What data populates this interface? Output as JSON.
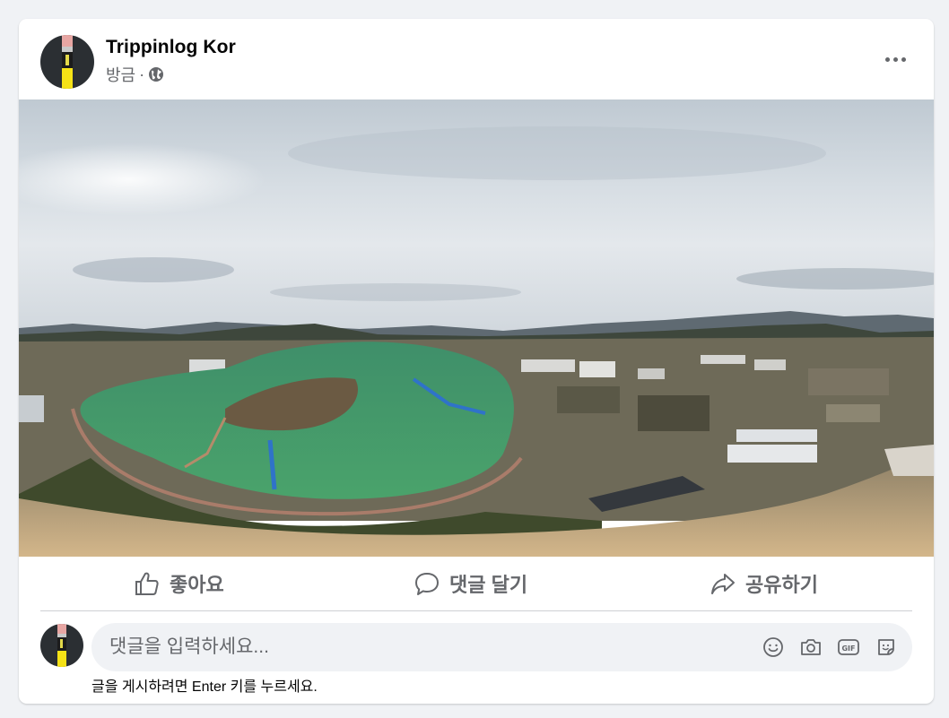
{
  "post": {
    "author": "Trippinlog Kor",
    "timestamp": "방금",
    "separator": "·",
    "privacy_icon": "globe-icon",
    "more_icon": "more-options-icon"
  },
  "photo": {
    "subject": "aerial panoramic photo of a lake and resort town"
  },
  "actions": {
    "like_label": "좋아요",
    "comment_label": "댓글 달기",
    "share_label": "공유하기"
  },
  "comment": {
    "placeholder": "댓글을 입력하세요...",
    "hint": "글을 게시하려면 Enter 키를 누르세요.",
    "icons": [
      "emoji-icon",
      "camera-icon",
      "gif-icon",
      "sticker-icon"
    ]
  },
  "colors": {
    "text_secondary": "#65676b",
    "text_primary": "#050505",
    "card_bg": "#ffffff",
    "page_bg": "#f0f2f5"
  }
}
